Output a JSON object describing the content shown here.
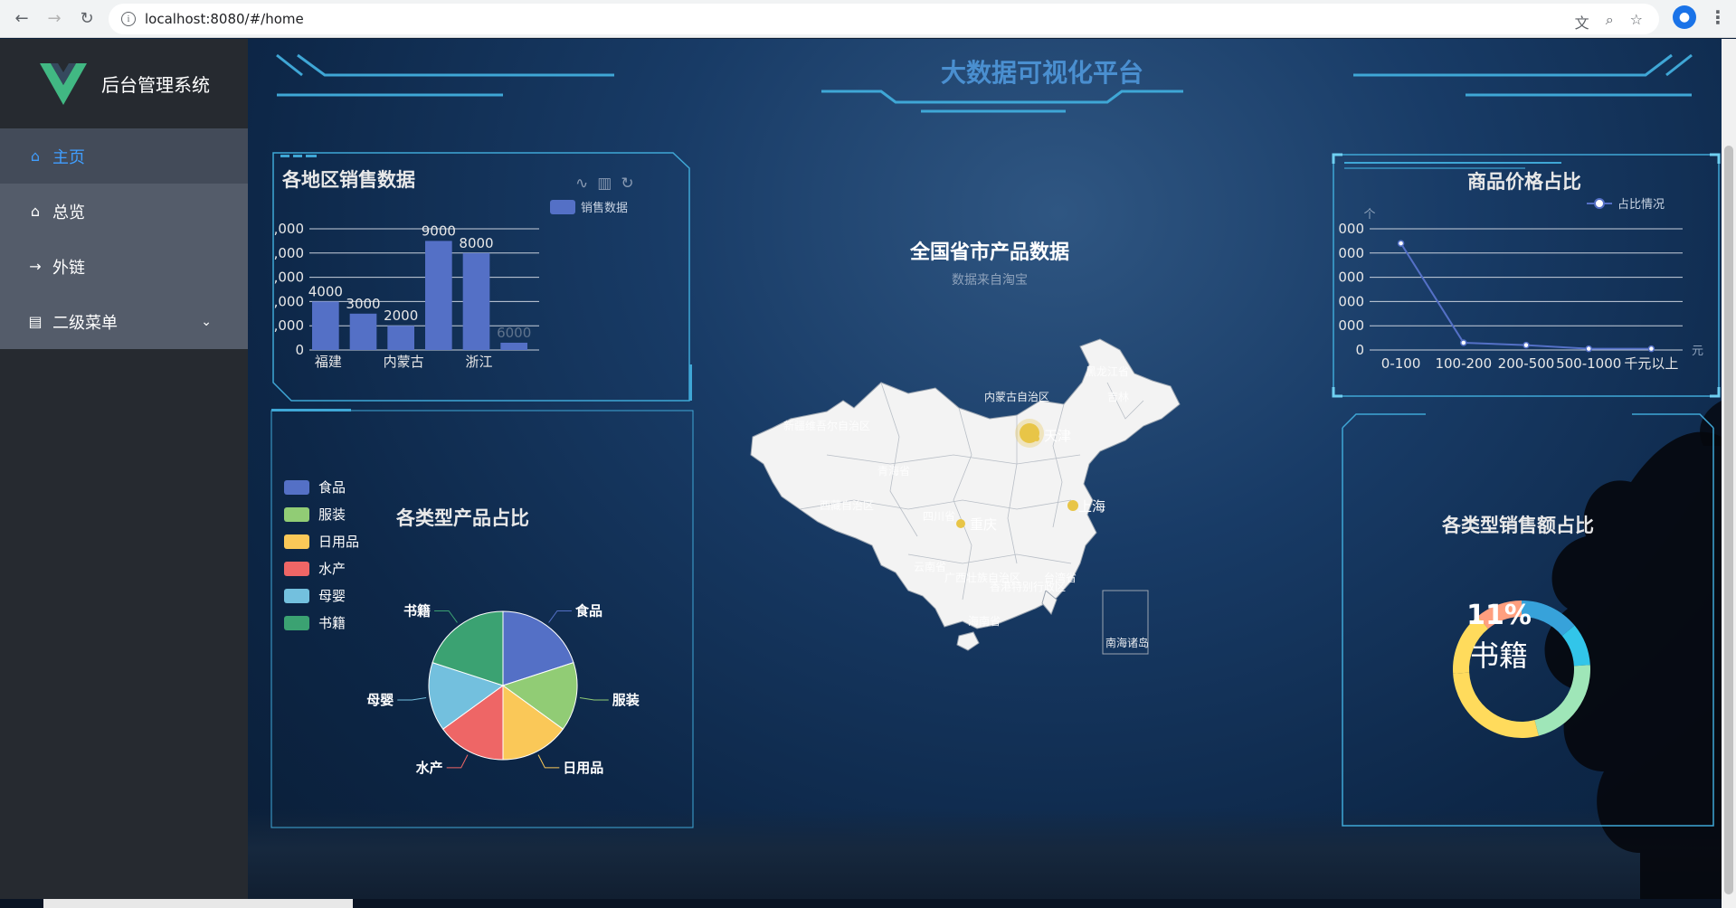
{
  "browser": {
    "url": "localhost:8080/#/home"
  },
  "sidebar": {
    "brand_text": "后台管理系统",
    "items": [
      {
        "label": "主页",
        "icon": "home-icon"
      },
      {
        "label": "总览",
        "icon": "home-icon"
      },
      {
        "label": "外链",
        "icon": "arrow-right-icon"
      },
      {
        "label": "二级菜单",
        "icon": "document-icon"
      }
    ]
  },
  "header": {
    "title": "大数据可视化平台"
  },
  "colors": {
    "accent": "#409eff",
    "bar": "#5470c6",
    "line": "#5470c6",
    "frame": "#3fa7d6"
  },
  "bar_panel": {
    "title": "各地区销售数据",
    "legend": "销售数据",
    "toolbox_icons": [
      "line-chart-icon",
      "bar-chart-icon",
      "refresh-icon"
    ]
  },
  "pie_panel": {
    "title": "各类型产品占比"
  },
  "map_panel": {
    "title": "全国省市产品数据",
    "subtitle": "数据来自淘宝",
    "inset_label": "南海诸岛",
    "cities": [
      "北京",
      "天津",
      "上海",
      "重庆"
    ],
    "provinces": [
      "黑龙江省",
      "吉林",
      "内蒙古自治区",
      "新疆维吾尔自治区",
      "青海省",
      "西藏自治区",
      "四川省",
      "云南省",
      "广西壮族自治区",
      "海南省",
      "台湾省",
      "广东省",
      "湖南省",
      "贵州省",
      "江西省",
      "浙江省",
      "福建省",
      "安徽省",
      "河南省",
      "陕西省",
      "甘肃省",
      "宁夏回族自治区",
      "山西省",
      "河北省",
      "山东省",
      "湖北省",
      "江苏省",
      "辽宁省",
      "香港特别行政区",
      "澳门特别行政区"
    ]
  },
  "line_panel": {
    "title": "商品价格占比",
    "legend": "占比情况",
    "yunit": "个",
    "xunit": "元"
  },
  "donut_panel": {
    "title": "各类型销售额占比",
    "center_percent": "11%",
    "center_label": "书籍"
  },
  "chart_data": [
    {
      "type": "bar",
      "title": "各地区销售数据",
      "series": [
        {
          "name": "销售数据",
          "values": [
            4000,
            3000,
            2000,
            9000,
            8000,
            600
          ]
        }
      ],
      "categories": [
        "福建",
        "",
        "内蒙古",
        "",
        "浙江",
        ""
      ],
      "category_labels_shown": [
        "福建",
        "内蒙古",
        "浙江"
      ],
      "data_labels": [
        "4000",
        "3000",
        "2000",
        "9000",
        "8000",
        "6000"
      ],
      "yticks": [
        "0",
        "2,000",
        "4,000",
        "6,000",
        "8,000",
        "10,000"
      ],
      "ylim": [
        0,
        10000
      ]
    },
    {
      "type": "pie",
      "title": "各类型产品占比",
      "categories": [
        "食品",
        "服装",
        "日用品",
        "水产",
        "母婴",
        "书籍"
      ],
      "values": [
        20,
        15,
        15,
        15,
        15,
        20
      ],
      "colors": [
        "#5470c6",
        "#91cc75",
        "#fac858",
        "#ee6666",
        "#73c0de",
        "#3ba272"
      ]
    },
    {
      "type": "line",
      "title": "商品价格占比",
      "series": [
        {
          "name": "占比情况",
          "values": [
            4.4,
            0.3,
            0.2,
            0.05,
            0.05
          ]
        }
      ],
      "categories": [
        "0-100",
        "100-200",
        "200-500",
        "500-1000",
        "千元以上"
      ],
      "yticks": [
        "0",
        "1,000",
        "2,000",
        "3,000",
        "4,000",
        "5,000"
      ],
      "ylim": [
        0,
        5
      ],
      "ylabel": "个",
      "xlabel": "元"
    },
    {
      "type": "pie",
      "title": "各类型销售额占比",
      "categories": [
        "书籍",
        "食品",
        "服装",
        "日用品",
        "水产",
        "母婴"
      ],
      "values": [
        11,
        14,
        10,
        22,
        28,
        15
      ],
      "colors": [
        "#ff9f7f",
        "#37a2da",
        "#32c5e9",
        "#9fe6b8",
        "#ffdb5c",
        "#ffdb5c"
      ],
      "highlight": {
        "percent": "11%",
        "name": "书籍"
      }
    }
  ]
}
